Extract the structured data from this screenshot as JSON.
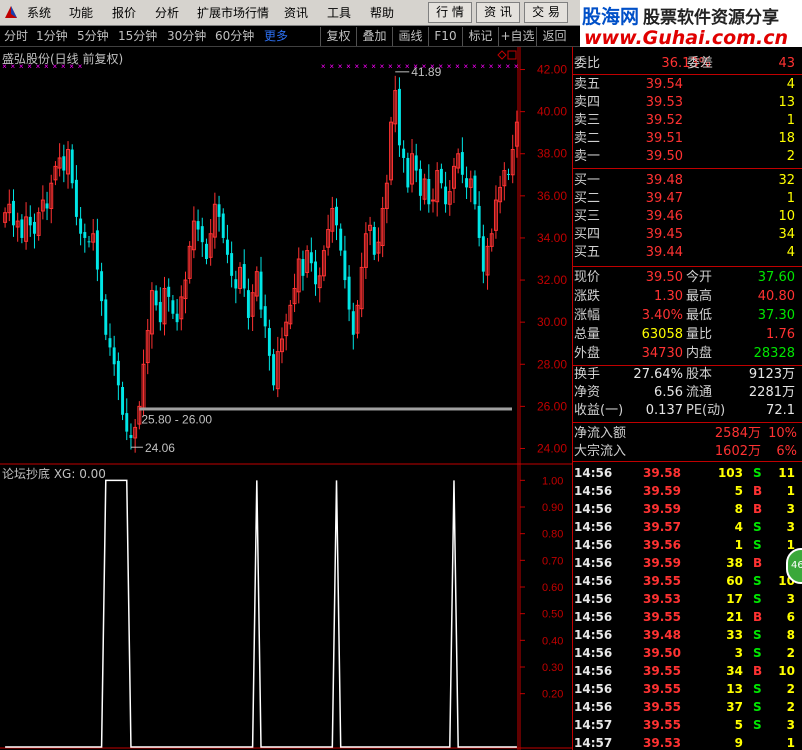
{
  "menu": {
    "items": [
      "系统",
      "功能",
      "报价",
      "分析",
      "扩展市场行情",
      "资讯",
      "工具",
      "帮助"
    ]
  },
  "right_tabs": [
    "行 情",
    "资 讯",
    "交 易"
  ],
  "site": {
    "brand": "股海网",
    "tagline": "股票软件资源分享",
    "url": "www.Guhai.com.cn"
  },
  "toolbar": {
    "periods": [
      "分时",
      "1分钟",
      "5分钟",
      "15分钟",
      "30分钟",
      "60分钟",
      "更多"
    ],
    "buttons": [
      "复权",
      "叠加",
      "画线",
      "F10",
      "标记",
      "+自选",
      "返回"
    ]
  },
  "main_chart": {
    "title": "盛弘股份(日线 前复权)",
    "high_label": "41.89",
    "low_label": "24.06",
    "range_label": "25.80 - 26.00"
  },
  "indicator": {
    "title": "论坛抄底 XG: 0.00"
  },
  "colors": {
    "up": "#ff3232",
    "down": "#00e6e6",
    "bg": "#000000",
    "grid": "#c00000",
    "marker": "#ff00ff"
  },
  "chart_data": [
    {
      "type": "candlestick",
      "title": "盛弘股份(日线 前复权)",
      "ylim": [
        23.5,
        42.5
      ],
      "y_ticks": [
        "42.00",
        "40.00",
        "38.00",
        "36.00",
        "34.00",
        "32.00",
        "30.00",
        "28.00",
        "26.00",
        "24.00"
      ],
      "annotations": [
        "41.89",
        "24.06",
        "25.80 - 26.00"
      ],
      "close": [
        35.2,
        35.6,
        34.6,
        34.8,
        34.0,
        35.0,
        34.6,
        34.2,
        35.2,
        35.8,
        35.4,
        36.6,
        37.4,
        37.8,
        37.2,
        38.2,
        36.6,
        35.0,
        34.2,
        34.0,
        33.8,
        34.2,
        32.5,
        31.0,
        29.4,
        28.8,
        28.0,
        27.0,
        25.6,
        24.8,
        24.5,
        25.0,
        26.0,
        28.0,
        29.6,
        31.5,
        30.8,
        30.0,
        31.6,
        31.2,
        30.4,
        30.0,
        31.2,
        32.0,
        33.6,
        34.8,
        34.4,
        33.8,
        33.0,
        34.2,
        35.6,
        35.0,
        34.0,
        33.2,
        32.2,
        31.6,
        32.6,
        31.6,
        30.2,
        31.4,
        32.4,
        30.6,
        29.8,
        28.4,
        27.0,
        28.6,
        29.2,
        30.0,
        30.8,
        31.6,
        33.0,
        32.2,
        33.4,
        32.8,
        31.8,
        32.2,
        33.4,
        34.4,
        35.4,
        34.6,
        33.4,
        32.0,
        30.6,
        29.4,
        30.8,
        32.6,
        34.2,
        34.6,
        33.2,
        33.8,
        35.4,
        36.6,
        39.5,
        41.0,
        38.4,
        37.8,
        36.4,
        38.0,
        37.2,
        36.0,
        36.8,
        35.6,
        35.8,
        37.2,
        36.6,
        35.6,
        36.2,
        37.4,
        38.0,
        37.0,
        36.4,
        36.8,
        35.6,
        34.0,
        32.4,
        33.6,
        34.2,
        35.8,
        36.4,
        37.2,
        37.0,
        38.2,
        39.5
      ]
    },
    {
      "type": "line",
      "title": "论坛抄底 XG: 0.00",
      "ylim": [
        0,
        1.05
      ],
      "y_ticks": [
        "1.00",
        "0.90",
        "0.80",
        "0.70",
        "0.60",
        "0.50",
        "0.40",
        "0.30",
        "0.20"
      ],
      "signal_days": [
        [
          24,
          29
        ],
        [
          60
        ],
        [
          79
        ],
        [
          107
        ]
      ]
    }
  ],
  "quote": {
    "weibi": {
      "label": "委比",
      "value": "36.13%",
      "label2": "委差",
      "value2": "43"
    },
    "sell": [
      {
        "label": "卖五",
        "price": "39.54",
        "vol": "4"
      },
      {
        "label": "卖四",
        "price": "39.53",
        "vol": "13"
      },
      {
        "label": "卖三",
        "price": "39.52",
        "vol": "1"
      },
      {
        "label": "卖二",
        "price": "39.51",
        "vol": "18"
      },
      {
        "label": "卖一",
        "price": "39.50",
        "vol": "2"
      }
    ],
    "buy": [
      {
        "label": "买一",
        "price": "39.48",
        "vol": "32"
      },
      {
        "label": "买二",
        "price": "39.47",
        "vol": "1"
      },
      {
        "label": "买三",
        "price": "39.46",
        "vol": "10"
      },
      {
        "label": "买四",
        "price": "39.45",
        "vol": "34"
      },
      {
        "label": "买五",
        "price": "39.44",
        "vol": "4"
      }
    ],
    "stats": [
      {
        "l1": "现价",
        "v1": "39.50",
        "c1": "red",
        "l2": "今开",
        "v2": "37.60",
        "c2": "green"
      },
      {
        "l1": "涨跌",
        "v1": "1.30",
        "c1": "red",
        "l2": "最高",
        "v2": "40.80",
        "c2": "red"
      },
      {
        "l1": "涨幅",
        "v1": "3.40%",
        "c1": "red",
        "l2": "最低",
        "v2": "37.30",
        "c2": "green"
      },
      {
        "l1": "总量",
        "v1": "63058",
        "c1": "yellow",
        "l2": "量比",
        "v2": "1.76",
        "c2": "red"
      },
      {
        "l1": "外盘",
        "v1": "34730",
        "c1": "red",
        "l2": "内盘",
        "v2": "28328",
        "c2": "green"
      }
    ],
    "fin": [
      {
        "l1": "换手",
        "v1": "27.64%",
        "l2": "股本",
        "v2": "9123万"
      },
      {
        "l1": "净资",
        "v1": "6.56",
        "l2": "流通",
        "v2": "2281万"
      },
      {
        "l1": "收益(一)",
        "v1": "0.137",
        "l2": "PE(动)",
        "v2": "72.1"
      }
    ],
    "flow": [
      {
        "label": "净流入额",
        "value": "2584万",
        "pct": "10%"
      },
      {
        "label": "大宗流入",
        "value": "1602万",
        "pct": "6%"
      }
    ]
  },
  "ticks": [
    {
      "time": "14:56",
      "price": "39.58",
      "vol": "103",
      "bs": "S",
      "n": "11"
    },
    {
      "time": "14:56",
      "price": "39.59",
      "vol": "5",
      "bs": "B",
      "n": "1"
    },
    {
      "time": "14:56",
      "price": "39.59",
      "vol": "8",
      "bs": "B",
      "n": "3"
    },
    {
      "time": "14:56",
      "price": "39.57",
      "vol": "4",
      "bs": "S",
      "n": "3"
    },
    {
      "time": "14:56",
      "price": "39.56",
      "vol": "1",
      "bs": "S",
      "n": "1"
    },
    {
      "time": "14:56",
      "price": "39.59",
      "vol": "38",
      "bs": "B",
      "n": "3"
    },
    {
      "time": "14:56",
      "price": "39.55",
      "vol": "60",
      "bs": "S",
      "n": "10"
    },
    {
      "time": "14:56",
      "price": "39.53",
      "vol": "17",
      "bs": "S",
      "n": "3"
    },
    {
      "time": "14:56",
      "price": "39.55",
      "vol": "21",
      "bs": "B",
      "n": "6"
    },
    {
      "time": "14:56",
      "price": "39.48",
      "vol": "33",
      "bs": "S",
      "n": "8"
    },
    {
      "time": "14:56",
      "price": "39.50",
      "vol": "3",
      "bs": "S",
      "n": "2"
    },
    {
      "time": "14:56",
      "price": "39.55",
      "vol": "34",
      "bs": "B",
      "n": "10"
    },
    {
      "time": "14:56",
      "price": "39.55",
      "vol": "13",
      "bs": "S",
      "n": "2"
    },
    {
      "time": "14:56",
      "price": "39.55",
      "vol": "37",
      "bs": "S",
      "n": "2"
    },
    {
      "time": "14:57",
      "price": "39.55",
      "vol": "5",
      "bs": "S",
      "n": "3"
    },
    {
      "time": "14:57",
      "price": "39.53",
      "vol": "9",
      "bs": "",
      "n": "1"
    }
  ],
  "float_badge": "46"
}
